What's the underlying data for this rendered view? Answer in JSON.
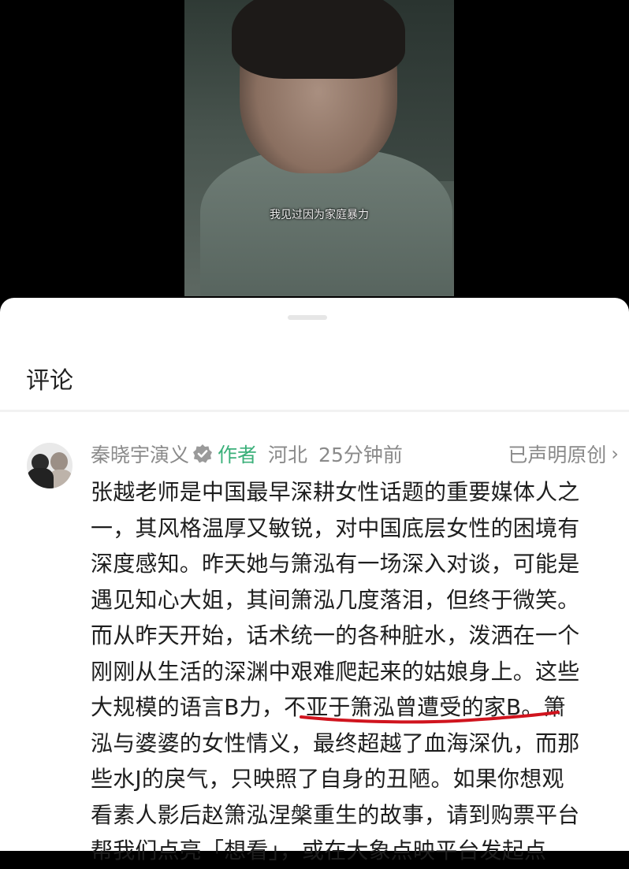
{
  "video": {
    "subtitle": "我见过因为家庭暴力"
  },
  "sheet": {
    "title": "评论"
  },
  "comment": {
    "author": "秦晓宇演义",
    "author_tag": "作者",
    "location": "河北",
    "time": "25分钟前",
    "original_label": "已声明原创",
    "lines": [
      "张越老师是中国最早深耕女性话题的重要媒体人之",
      "一，其风格温厚又敏锐，对中国底层女性的困境有",
      "深度感知。昨天她与箫泓有一场深入对谈，可能是",
      "遇见知心大姐，其间箫泓几度落泪，但终于微笑。",
      "而从昨天开始，话术统一的各种脏水，泼洒在一个",
      "刚刚从生活的深渊中艰难爬起来的姑娘身上。这些",
      "大规模的语言B力，不亚于箫泓曾遭受的家B。箫",
      "泓与婆婆的女性情义，最终超越了血海深仇，而那",
      "些水J的戾气，只映照了自身的丑陋。如果你想观",
      "看素人影后赵箫泓涅槃重生的故事，请到购票平台",
      "帮我们点亮「想看」，或在大象点映平台发起点"
    ]
  },
  "colors": {
    "author_tag": "#3bb07a",
    "annotation": "#d0141e"
  }
}
